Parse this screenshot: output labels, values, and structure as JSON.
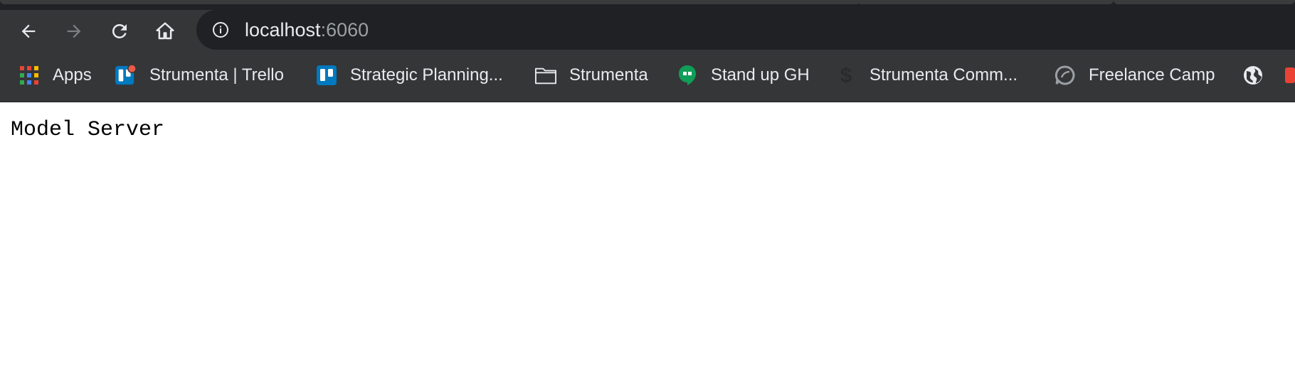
{
  "browser": {
    "address_bar": {
      "host": "localhost",
      "port_suffix": ":6060"
    },
    "nav_buttons": {
      "back": "back-arrow-icon",
      "forward": "forward-arrow-icon",
      "reload": "reload-icon",
      "home": "home-icon"
    },
    "bookmarks": [
      {
        "label": "Apps",
        "icon": "apps-grid-icon"
      },
      {
        "label": "Strumenta | Trello",
        "icon": "trello-icon"
      },
      {
        "label": "Strategic Planning...",
        "icon": "trello-icon"
      },
      {
        "label": "Strumenta",
        "icon": "folder-icon"
      },
      {
        "label": "Stand up GH",
        "icon": "hangouts-icon"
      },
      {
        "label": "Strumenta Comm...",
        "icon": "dollar-icon"
      },
      {
        "label": "Freelance Camp",
        "icon": "chat-bubble-icon"
      },
      {
        "label": "",
        "icon": "globe-icon"
      }
    ]
  },
  "page": {
    "heading": "Model Server"
  },
  "colors": {
    "chrome_background": "#353638",
    "omnibox_background": "#202124",
    "text_light": "#e8eaed",
    "text_dim": "#9aa0a6",
    "trello_blue": "#0079bf",
    "notification_red": "#eb5a46",
    "hangouts_green": "#0f9d58"
  }
}
